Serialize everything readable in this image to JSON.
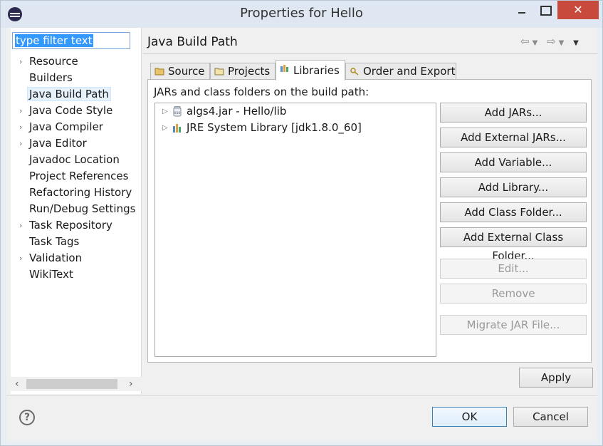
{
  "window": {
    "title": "Properties for Hello"
  },
  "filter": {
    "value": "type filter text"
  },
  "tree": {
    "items": [
      {
        "label": "Resource",
        "expandable": true
      },
      {
        "label": "Builders",
        "expandable": false
      },
      {
        "label": "Java Build Path",
        "expandable": false,
        "selected": true
      },
      {
        "label": "Java Code Style",
        "expandable": true
      },
      {
        "label": "Java Compiler",
        "expandable": true
      },
      {
        "label": "Java Editor",
        "expandable": true
      },
      {
        "label": "Javadoc Location",
        "expandable": false
      },
      {
        "label": "Project References",
        "expandable": false
      },
      {
        "label": "Refactoring History",
        "expandable": false
      },
      {
        "label": "Run/Debug Settings",
        "expandable": false
      },
      {
        "label": "Task Repository",
        "expandable": true
      },
      {
        "label": "Task Tags",
        "expandable": false
      },
      {
        "label": "Validation",
        "expandable": true
      },
      {
        "label": "WikiText",
        "expandable": false
      }
    ]
  },
  "page": {
    "title": "Java Build Path"
  },
  "tabs": [
    {
      "label": "Source"
    },
    {
      "label": "Projects"
    },
    {
      "label": "Libraries",
      "active": true
    },
    {
      "label": "Order and Export"
    }
  ],
  "libraries": {
    "label": "JARs and class folders on the build path:",
    "entries": [
      {
        "label": "algs4.jar - Hello/lib",
        "icon": "jar-icon"
      },
      {
        "label": "JRE System Library [jdk1.8.0_60]",
        "icon": "library-icon"
      }
    ],
    "buttons": {
      "add_jars": "Add JARs...",
      "add_external_jars": "Add External JARs...",
      "add_variable": "Add Variable...",
      "add_library": "Add Library...",
      "add_class_folder": "Add Class Folder...",
      "add_external_class_folder": "Add External Class Folder...",
      "edit": "Edit...",
      "remove": "Remove",
      "migrate_jar": "Migrate JAR File..."
    }
  },
  "footer": {
    "apply": "Apply",
    "ok": "OK",
    "cancel": "Cancel",
    "help": "?"
  },
  "colors": {
    "selection": "#3399ff",
    "close_button": "#c74a3c",
    "ok_border": "#3c7fb1"
  }
}
